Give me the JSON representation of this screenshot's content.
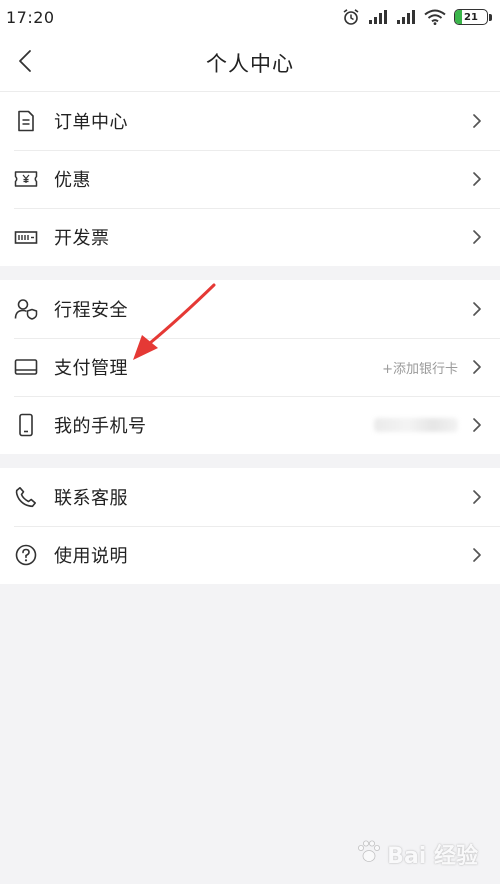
{
  "status_bar": {
    "time": "17:20",
    "battery_level": "21",
    "battery_percent": 0.21,
    "icons": [
      "alarm-icon",
      "signal-icon",
      "signal-icon",
      "wifi-icon",
      "battery-icon"
    ],
    "battery_color": "#3ab54a"
  },
  "header": {
    "title": "个人中心",
    "back_icon": "chevron-left-icon"
  },
  "groups": [
    {
      "items": [
        {
          "label": "订单中心",
          "icon": "document-icon"
        },
        {
          "label": "优惠",
          "icon": "coupon-icon"
        },
        {
          "label": "开发票",
          "icon": "invoice-icon"
        }
      ]
    },
    {
      "items": [
        {
          "label": "行程安全",
          "icon": "safety-icon"
        },
        {
          "label": "支付管理",
          "icon": "card-icon",
          "value": "+添加银行卡"
        },
        {
          "label": "我的手机号",
          "icon": "phone-icon"
        }
      ]
    },
    {
      "items": [
        {
          "label": "联系客服",
          "icon": "telephone-icon"
        },
        {
          "label": "使用说明",
          "icon": "help-icon"
        }
      ]
    }
  ],
  "watermark": {
    "text": "Bai 经验"
  },
  "colors": {
    "background": "#f3f3f5",
    "card": "#ffffff",
    "annotation": "#e53935",
    "secondary_text": "#9a9a9a"
  }
}
